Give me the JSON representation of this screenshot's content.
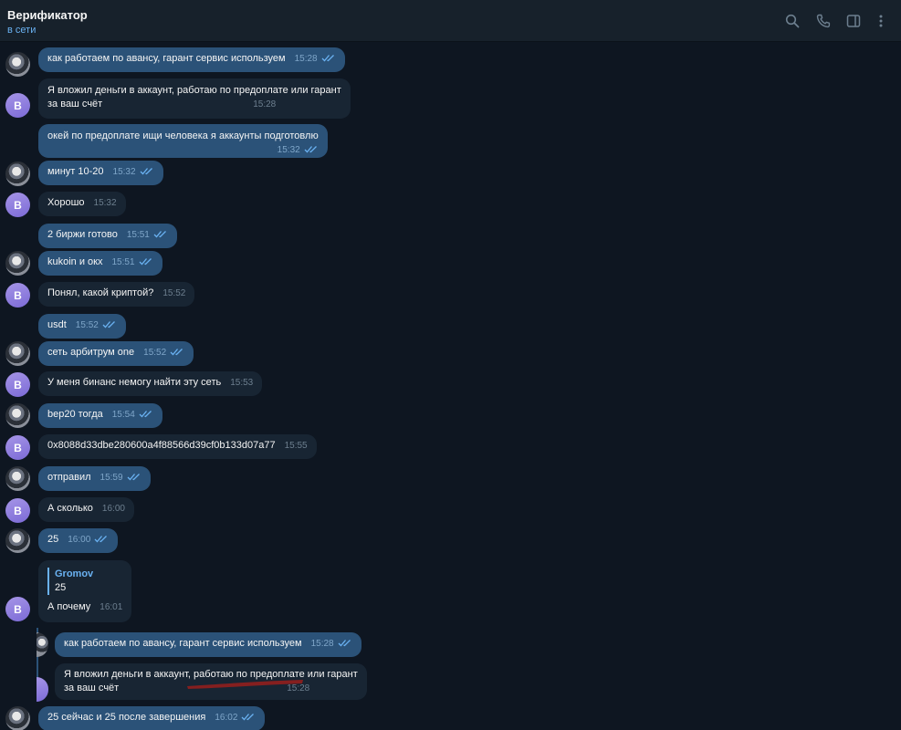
{
  "header": {
    "title": "Верификатор",
    "status": "в сети",
    "icons": [
      "search-icon",
      "phone-icon",
      "sidebar-icon",
      "more-icon"
    ]
  },
  "avatar_letter": "В",
  "messages": [
    {
      "dir": "out",
      "text": "как работаем по авансу, гарант сервис используем",
      "time": "15:28"
    },
    {
      "dir": "in",
      "text": "Я вложил деньги в аккаунт, работаю по предоплате или гарант",
      "text2": "за ваш счёт",
      "time": "15:28"
    },
    {
      "dir": "out",
      "text": "окей по предоплате ищи человека я аккаунты подготовлю",
      "time": "15:32"
    },
    {
      "dir": "out",
      "text": "минут 10-20",
      "time": "15:32"
    },
    {
      "dir": "in",
      "text": "Хорошо",
      "time": "15:32"
    },
    {
      "dir": "out",
      "text": "2 биржи готово",
      "time": "15:51"
    },
    {
      "dir": "out",
      "text": "kukoin и окх",
      "time": "15:51"
    },
    {
      "dir": "in",
      "text": "Понял, какой криптой?",
      "time": "15:52"
    },
    {
      "dir": "out",
      "text": "usdt",
      "time": "15:52"
    },
    {
      "dir": "out",
      "text": "сеть арбитрум one",
      "time": "15:52"
    },
    {
      "dir": "in",
      "text": "У меня бинанс немогу найти эту сеть",
      "time": "15:53"
    },
    {
      "dir": "out",
      "text": "bep20 тогда",
      "time": "15:54"
    },
    {
      "dir": "in",
      "text": "0x8088d33dbe280600a4f88566d39cf0b133d07a77",
      "time": "15:55"
    },
    {
      "dir": "out",
      "text": "отправил",
      "time": "15:59"
    },
    {
      "dir": "in",
      "text": "А сколько",
      "time": "16:00"
    },
    {
      "dir": "out",
      "text": "25",
      "time": "16:00"
    },
    {
      "dir": "in",
      "quote_name": "Gromov",
      "quote_text": "25",
      "text": "А почему",
      "time": "16:01"
    },
    {
      "dir": "out",
      "text": "как работаем по авансу, гарант сервис используем",
      "time": "15:28"
    },
    {
      "dir": "in",
      "text": "Я вложил деньги в аккаунт, работаю по предоплате или гарант",
      "text2": "за ваш счёт",
      "time": "15:28"
    },
    {
      "dir": "out",
      "text": "25 сейчас и 25 после завершения",
      "time": "16:02"
    }
  ],
  "colors": {
    "background": "#0e1621",
    "header": "#17212b",
    "outgoing_bubble": "#2b5278",
    "incoming_bubble": "#182533",
    "accent": "#6ab2f2",
    "underline_mark": "#8b1f1f"
  }
}
